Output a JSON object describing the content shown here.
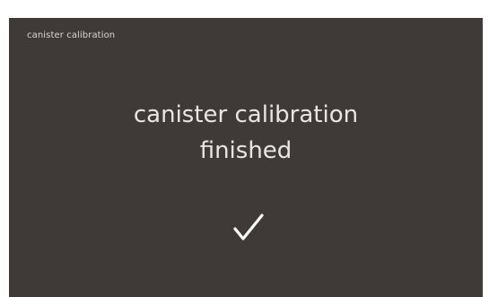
{
  "header": {
    "title": "canister calibration"
  },
  "message": {
    "line1": "canister calibration",
    "line2": "finished"
  },
  "status": {
    "icon": "checkmark-icon"
  },
  "colors": {
    "screen_background": "#3f3a37",
    "text": "#e8e6e3",
    "checkmark": "#ffffff"
  }
}
